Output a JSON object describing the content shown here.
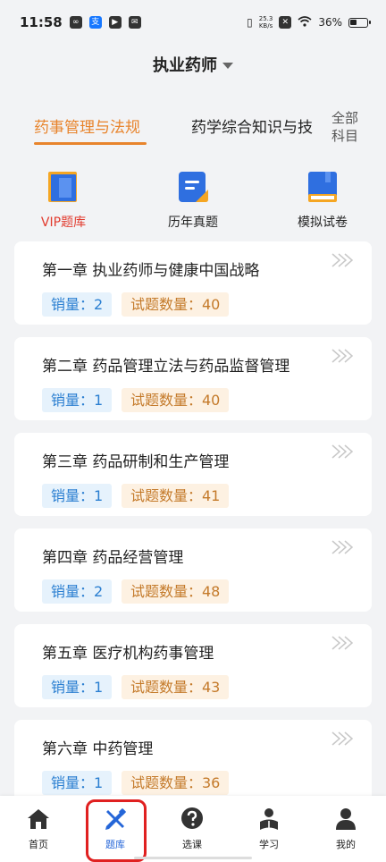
{
  "status": {
    "time": "11:58",
    "speed_value": "25.3",
    "speed_unit": "KB/s",
    "battery": "36%"
  },
  "header": {
    "title": "执业药师"
  },
  "subject_tabs": {
    "active": "药事管理与法规",
    "other": "药学综合知识与技",
    "all_label_line1": "全部",
    "all_label_line2": "科目"
  },
  "quick": [
    {
      "label": "VIP题库",
      "icon": "vip-question-bank-icon"
    },
    {
      "label": "历年真题",
      "icon": "past-exams-icon"
    },
    {
      "label": "模拟试卷",
      "icon": "mock-exam-icon"
    }
  ],
  "chapters": [
    {
      "title": "第一章 执业药师与健康中国战略",
      "sales": "销量：2",
      "count": "试题数量：40"
    },
    {
      "title": "第二章 药品管理立法与药品监督管理",
      "sales": "销量：1",
      "count": "试题数量：40"
    },
    {
      "title": "第三章 药品研制和生产管理",
      "sales": "销量：1",
      "count": "试题数量：41"
    },
    {
      "title": "第四章 药品经营管理",
      "sales": "销量：2",
      "count": "试题数量：48"
    },
    {
      "title": "第五章 医疗机构药事管理",
      "sales": "销量：1",
      "count": "试题数量：43"
    },
    {
      "title": "第六章 中药管理",
      "sales": "销量：1",
      "count": "试题数量：36"
    }
  ],
  "nav": [
    {
      "label": "首页",
      "icon": "home-icon"
    },
    {
      "label": "题库",
      "icon": "question-bank-icon",
      "active": true
    },
    {
      "label": "选课",
      "icon": "question-circle-icon"
    },
    {
      "label": "学习",
      "icon": "study-icon"
    },
    {
      "label": "我的",
      "icon": "profile-icon"
    }
  ],
  "colors": {
    "accent": "#e8842c",
    "nav_active": "#2566d8",
    "highlight_box": "#e02020"
  }
}
